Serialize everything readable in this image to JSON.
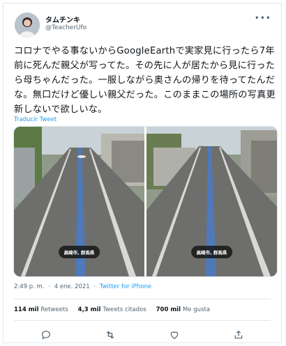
{
  "tweet": {
    "author_name": "タムチンキ",
    "author_handle": "@TeacherUfo",
    "text": "コロナでやる事ないからGoogleEarthで実家見に行ったら7年前に死んだ親父が写ってた。その先に人が居たから見に行ったら母ちゃんだった。一服しながら奥さんの帰りを待ってたんだな。無口だけど優しい親父だった。このままこの場所の写真更新しないで欲しいな。",
    "translate_label": "Traducir Tweet",
    "photos": [
      {
        "location_label": "高崎市, 群馬県"
      },
      {
        "location_label": "高崎市, 群馬県"
      }
    ],
    "time": "2:49 p. m.",
    "separator": "·",
    "date": "4 ene. 2021",
    "source": "Twitter for iPhone",
    "stats": {
      "retweets_count": "114 mil",
      "retweets_label": "Retweets",
      "quotes_count": "4,3 mil",
      "quotes_label": "Tweets citados",
      "likes_count": "700 mil",
      "likes_label": "Me gusta"
    }
  },
  "icons": [
    "more-icon",
    "reply-icon",
    "retweet-icon",
    "like-icon",
    "share-icon"
  ],
  "colors": {
    "link": "#1d9bf0",
    "secondary": "#536471",
    "text": "#0f1419",
    "border": "#e1e8ed"
  }
}
